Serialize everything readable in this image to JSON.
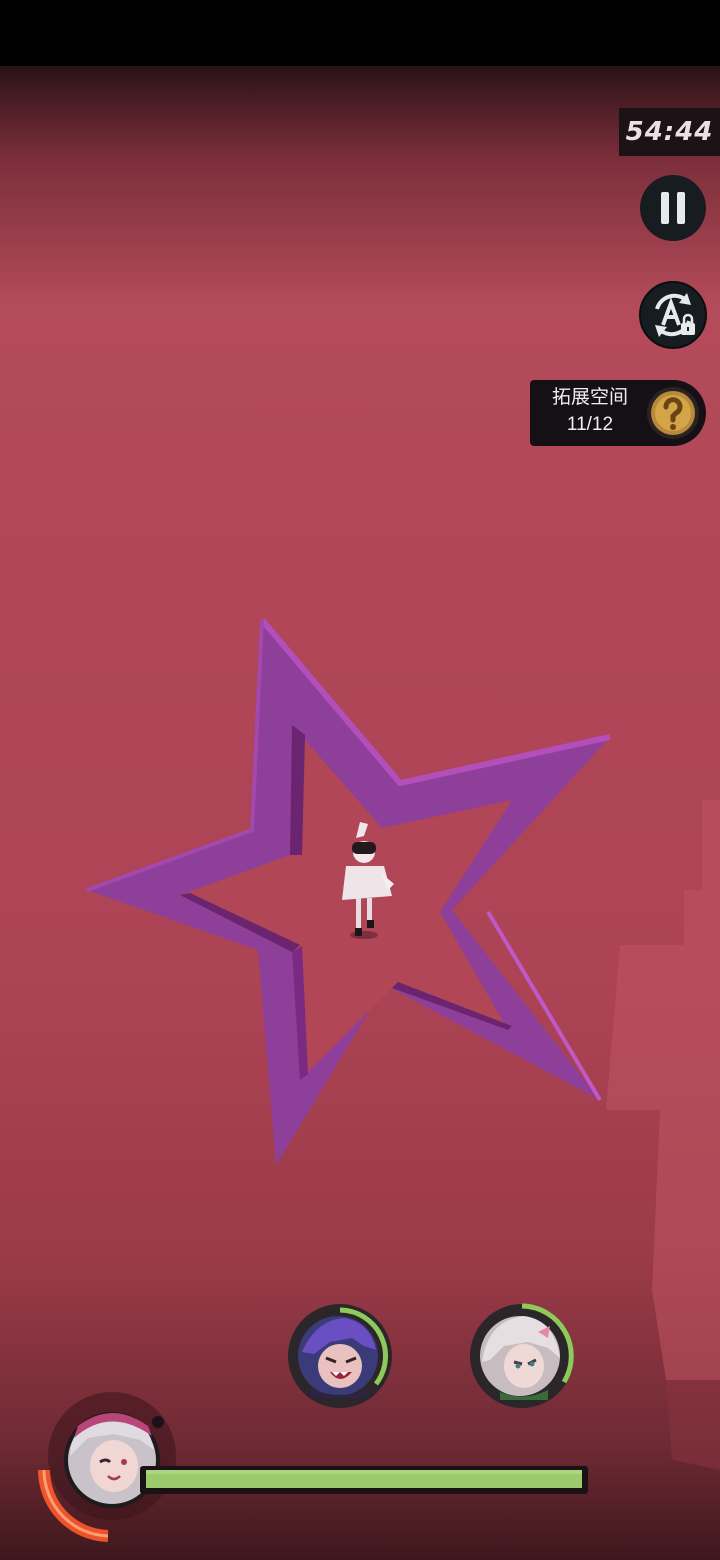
{
  "hud": {
    "timer": "54:44",
    "quest": {
      "title": "拓展空间",
      "progress": "11/12",
      "icon": "question-coin-icon"
    },
    "pause_icon": "pause-icon",
    "auto_icon": "auto-locked-icon"
  },
  "party": {
    "allies": [
      {
        "name": "purple-hair-ally",
        "skill_ready_fraction": 0.45
      },
      {
        "name": "white-hair-ally",
        "skill_ready_fraction": 0.55
      }
    ],
    "leader": {
      "name": "leader-portrait",
      "hp_fraction": 1.0,
      "energy_fraction": 0.3
    }
  },
  "colors": {
    "background": "#b04656",
    "star_wall": "#8e3f9a",
    "hp_fill": "#9ccb6b",
    "energy": "#ff5a2a",
    "ally_ring": "#8fc95a"
  }
}
